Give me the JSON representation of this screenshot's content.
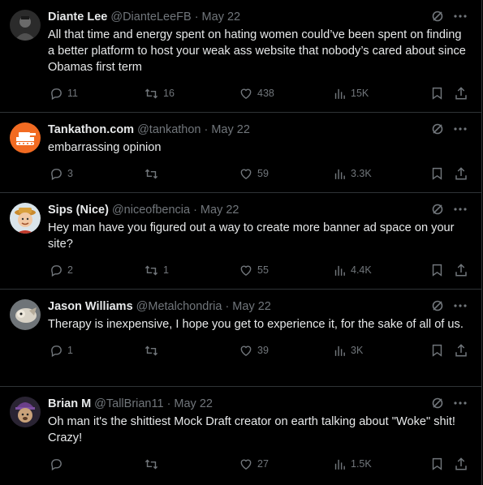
{
  "tweets": [
    {
      "name": "Diante Lee",
      "handle": "@DianteLeeFB",
      "date": "May 22",
      "text": "All that time and energy spent on hating women could’ve been spent on finding a better platform to host your weak ass website that nobody’s cared about since Obamas first term",
      "replies": "11",
      "retweets": "16",
      "likes": "438",
      "views": "15K",
      "avatar_color": "#3a3a3a"
    },
    {
      "name": "Tankathon.com",
      "handle": "@tankathon",
      "date": "May 22",
      "text": "embarrassing opinion",
      "replies": "3",
      "retweets": "",
      "likes": "59",
      "views": "3.3K",
      "avatar_color": "#f26b22"
    },
    {
      "name": "Sips (Nice)",
      "handle": "@niceofbencia",
      "date": "May 22",
      "text": "Hey man have you figured out a way to create more banner ad space on your site?",
      "replies": "2",
      "retweets": "1",
      "likes": "55",
      "views": "4.4K",
      "avatar_color": "#e8d7b4"
    },
    {
      "name": "Jason Williams",
      "handle": "@Metalchondria",
      "date": "May 22",
      "text": "Therapy is inexpensive, I hope you get to experience it, for the sake of all of us.",
      "replies": "1",
      "retweets": "",
      "likes": "39",
      "views": "3K",
      "avatar_color": "#8a8f93"
    },
    {
      "name": "Brian M",
      "handle": "@TallBrian11",
      "date": "May 22",
      "text": "Oh man it's the shittiest Mock Draft creator on earth talking about \"Woke\" shit! Crazy!",
      "replies": "",
      "retweets": "",
      "likes": "27",
      "views": "1.5K",
      "avatar_color": "#6b4a8a"
    }
  ],
  "separator_dot": "·",
  "colors": {
    "background": "#000000",
    "text": "#e7e9ea",
    "muted": "#71767b",
    "border": "#2f3336"
  }
}
